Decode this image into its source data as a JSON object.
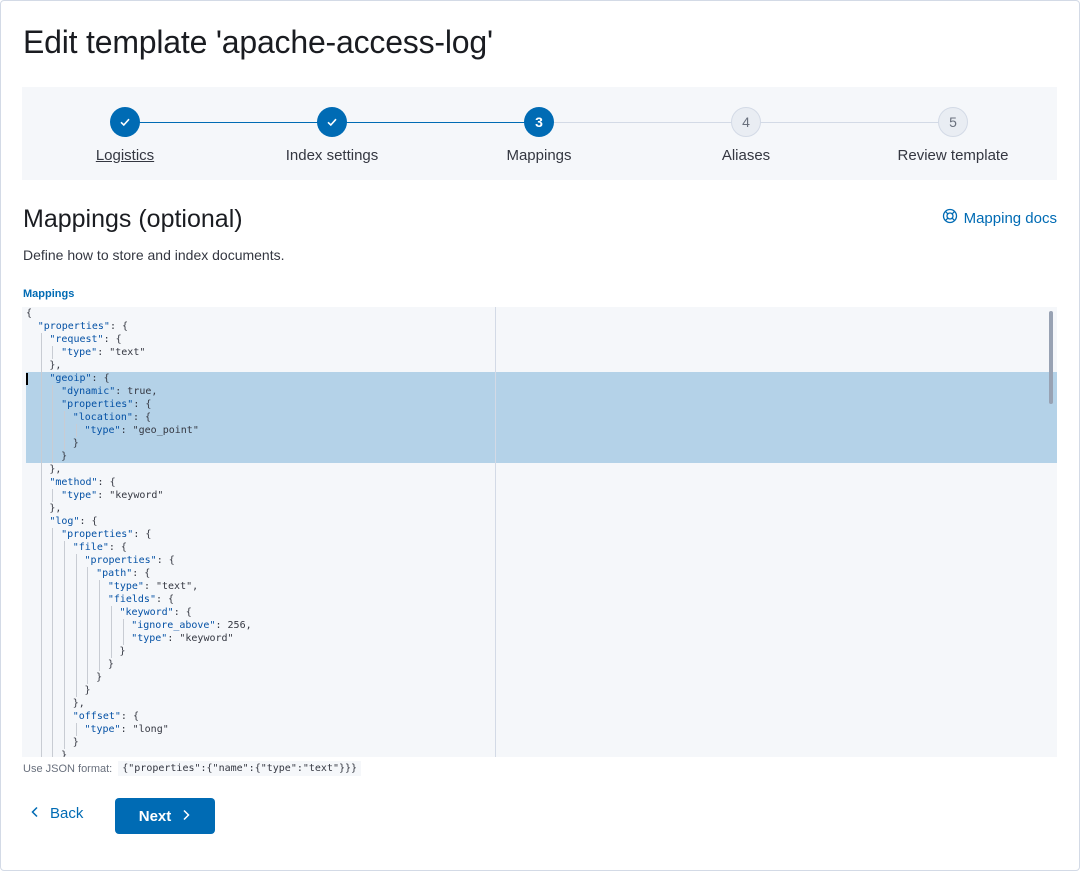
{
  "page": {
    "title": "Edit template 'apache-access-log'"
  },
  "steps": [
    {
      "label": "Logistics",
      "status": "complete",
      "number": "1"
    },
    {
      "label": "Index settings",
      "status": "complete",
      "number": "2"
    },
    {
      "label": "Mappings",
      "status": "current",
      "number": "3"
    },
    {
      "label": "Aliases",
      "status": "incomplete",
      "number": "4"
    },
    {
      "label": "Review template",
      "status": "incomplete",
      "number": "5"
    }
  ],
  "section": {
    "title": "Mappings (optional)",
    "description": "Define how to store and index documents.",
    "docs_link": "Mapping docs",
    "docs_icon": "lifebuoy-icon"
  },
  "editor": {
    "label": "Mappings",
    "lines": [
      "{",
      "  \"properties\": {",
      "    \"request\": {",
      "      \"type\": \"text\"",
      "    },",
      "    \"geoip\": {",
      "      \"dynamic\": true,",
      "      \"properties\": {",
      "        \"location\": {",
      "          \"type\": \"geo_point\"",
      "        }",
      "      }",
      "    },",
      "    \"method\": {",
      "      \"type\": \"keyword\"",
      "    },",
      "    \"log\": {",
      "      \"properties\": {",
      "        \"file\": {",
      "          \"properties\": {",
      "            \"path\": {",
      "              \"type\": \"text\",",
      "              \"fields\": {",
      "                \"keyword\": {",
      "                  \"ignore_above\": 256,",
      "                  \"type\": \"keyword\"",
      "                }",
      "              }",
      "            }",
      "          }",
      "        },",
      "        \"offset\": {",
      "          \"type\": \"long\"",
      "        }",
      "      }"
    ]
  },
  "help": {
    "prefix": "Use JSON format:",
    "example": "{\"properties\":{\"name\":{\"type\":\"text\"}}}"
  },
  "buttons": {
    "back": "Back",
    "next": "Next"
  },
  "colors": {
    "primary": "#006bb4",
    "selection": "#b4d2e8",
    "panel": "#f5f7fa"
  }
}
